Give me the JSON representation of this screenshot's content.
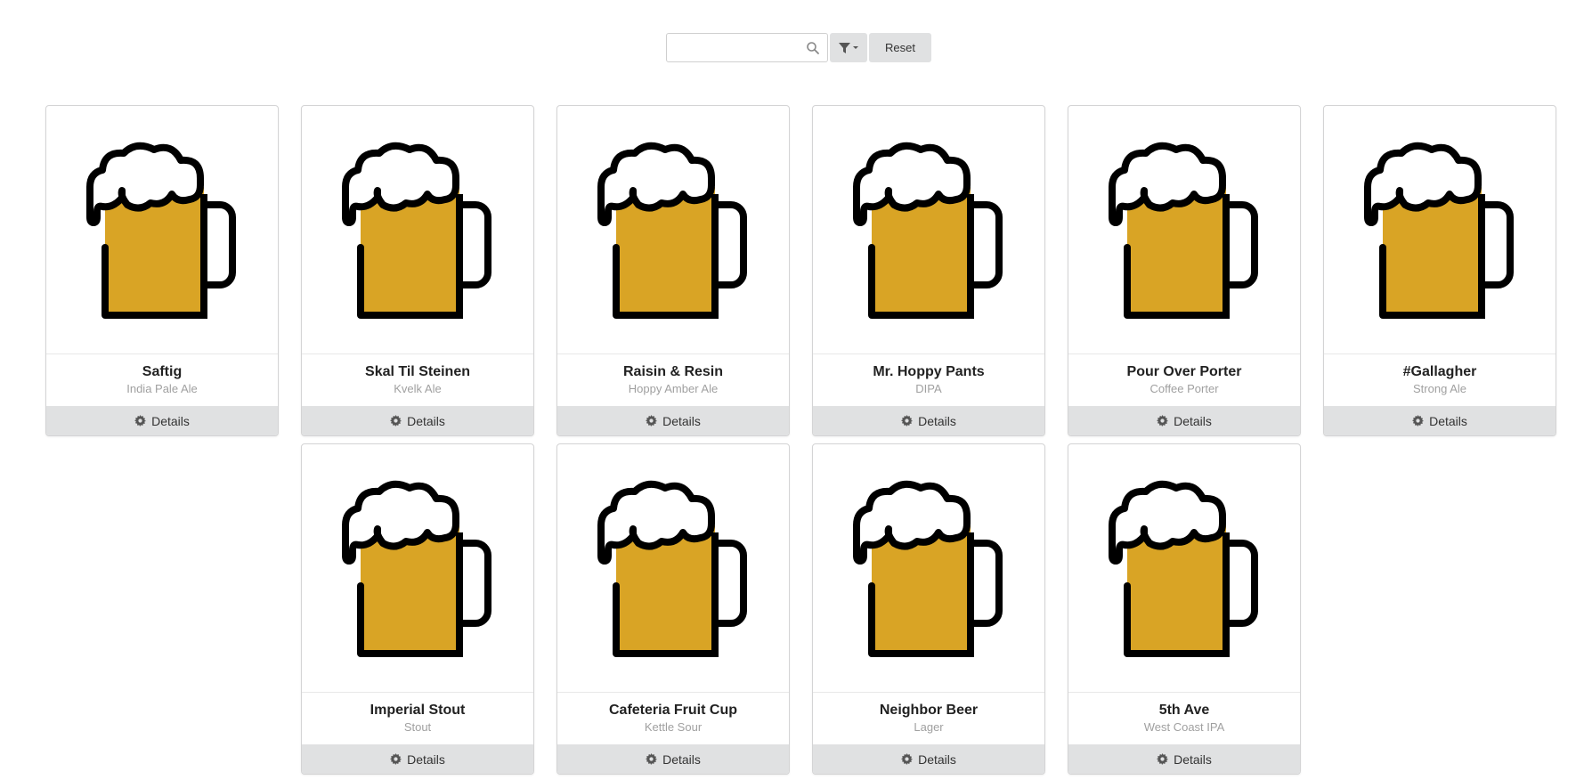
{
  "search": {
    "value": "",
    "placeholder": "",
    "icon": "search-icon"
  },
  "filter": {
    "icon": "filter-icon"
  },
  "reset": {
    "label": "Reset"
  },
  "colors": {
    "beer": "#d9a425",
    "button_bg": "#e0e1e2"
  },
  "beers": [
    {
      "name": "Saftig",
      "style": "India Pale Ale",
      "details_label": "Details"
    },
    {
      "name": "Skal Til Steinen",
      "style": "Kvelk Ale",
      "details_label": "Details"
    },
    {
      "name": "Raisin & Resin",
      "style": "Hoppy Amber Ale",
      "details_label": "Details"
    },
    {
      "name": "Mr. Hoppy Pants",
      "style": "DIPA",
      "details_label": "Details"
    },
    {
      "name": "Pour Over Porter",
      "style": "Coffee Porter",
      "details_label": "Details"
    },
    {
      "name": "#Gallagher",
      "style": "Strong Ale",
      "details_label": "Details"
    },
    {
      "name": "Imperial Stout",
      "style": "Stout",
      "details_label": "Details"
    },
    {
      "name": "Cafeteria Fruit Cup",
      "style": "Kettle Sour",
      "details_label": "Details"
    },
    {
      "name": "Neighbor Beer",
      "style": "Lager",
      "details_label": "Details"
    },
    {
      "name": "5th Ave",
      "style": "West Coast IPA",
      "details_label": "Details"
    }
  ]
}
